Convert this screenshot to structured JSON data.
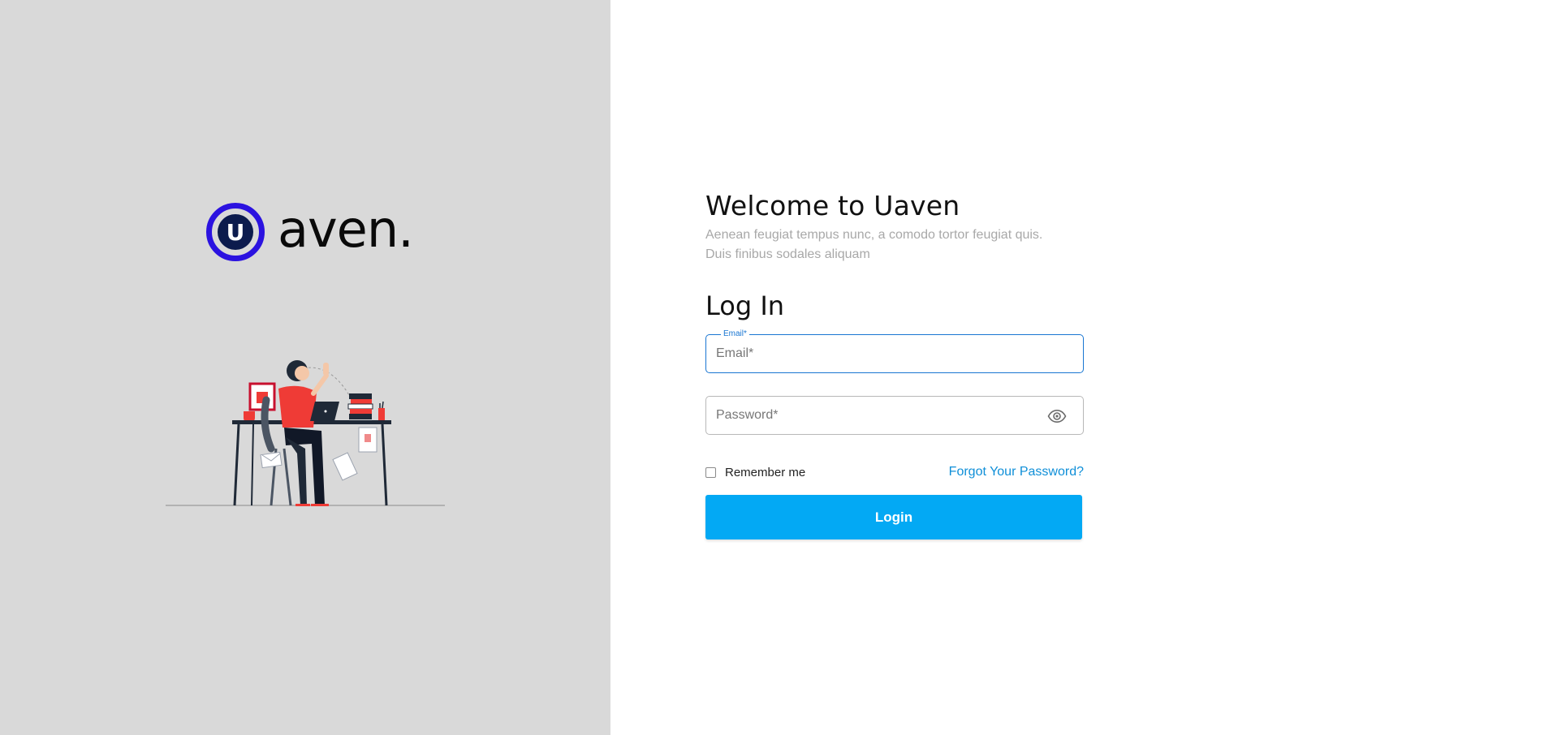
{
  "brand": {
    "logo_letter": "U",
    "logo_word": "aven.",
    "colors": {
      "logo_ring": "#2b12e0",
      "logo_fill": "#0c1b4d",
      "left_panel": "#d9d9d9",
      "primary": "#03a9f4",
      "link": "#0f8fd8",
      "focus": "#1976d2"
    }
  },
  "illustration": {
    "name": "woman-working-at-desk-illustration"
  },
  "form": {
    "welcome_title": "Welcome to Uaven",
    "subtitle": "Aenean feugiat tempus nunc, a comodo tortor feugiat quis. Duis finibus sodales aliquam",
    "login_title": "Log In",
    "email": {
      "label": "Email*",
      "placeholder": "Email*",
      "value": ""
    },
    "password": {
      "placeholder": "Password*",
      "value": "",
      "toggle_icon": "eye-icon"
    },
    "remember_label": "Remember me",
    "remember_checked": false,
    "forgot_link": "Forgot Your Password?",
    "login_button": "Login"
  }
}
